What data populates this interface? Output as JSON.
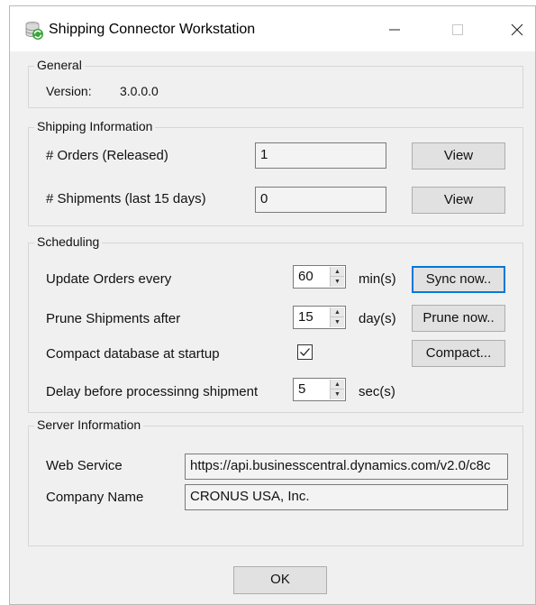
{
  "window": {
    "title": "Shipping Connector Workstation",
    "controls": {
      "minimize": "—",
      "maximize": "☐",
      "close": "✕"
    }
  },
  "general": {
    "group_label": "General",
    "version_label": "Version:",
    "version_value": "3.0.0.0"
  },
  "shipping": {
    "group_label": "Shipping Information",
    "orders_label": "# Orders (Released)",
    "orders_value": "1",
    "orders_view": "View",
    "shipments_label": "# Shipments (last 15 days)",
    "shipments_value": "0",
    "shipments_view": "View"
  },
  "scheduling": {
    "group_label": "Scheduling",
    "update_label": "Update Orders every",
    "update_value": "60",
    "update_unit": "min(s)",
    "sync_button": "Sync now..",
    "prune_label": "Prune Shipments after",
    "prune_value": "15",
    "prune_unit": "day(s)",
    "prune_button": "Prune now..",
    "compact_label": "Compact database at startup",
    "compact_checked": true,
    "compact_button": "Compact...",
    "delay_label": "Delay before processinng shipment",
    "delay_value": "5",
    "delay_unit": "sec(s)"
  },
  "server": {
    "group_label": "Server Information",
    "webservice_label": "Web Service",
    "webservice_value": "https://api.businesscentral.dynamics.com/v2.0/c8c",
    "company_label": "Company Name",
    "company_value": "CRONUS USA, Inc."
  },
  "footer": {
    "ok_button": "OK"
  },
  "colors": {
    "accent": "#0078d7",
    "window_bg": "#f0f0f0",
    "button_bg": "#e1e1e1"
  }
}
